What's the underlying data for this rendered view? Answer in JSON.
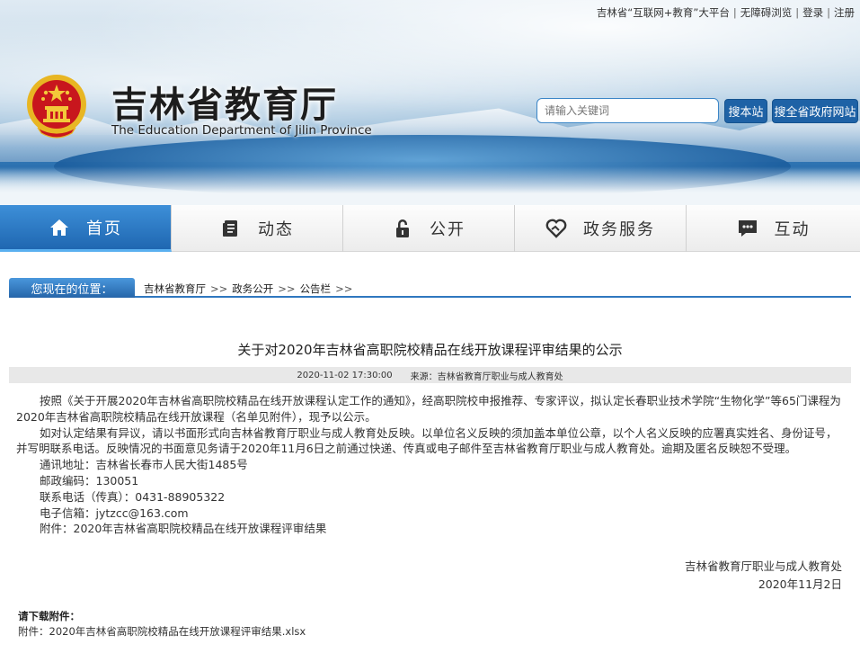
{
  "top_links": [
    "吉林省“互联网+教育”大平台",
    "无障碍浏览",
    "登录",
    "注册"
  ],
  "header": {
    "title": "吉林省教育厅",
    "subtitle": "The Education Department of Jilin Province",
    "search_placeholder": "请输入关键词",
    "search_site_label": "搜本站",
    "search_gov_label": "搜全省政府网站"
  },
  "nav": [
    {
      "label": "首页",
      "icon": "home-icon",
      "active": true
    },
    {
      "label": "动态",
      "icon": "document-icon",
      "active": false
    },
    {
      "label": "公开",
      "icon": "lock-icon",
      "active": false
    },
    {
      "label": "政务服务",
      "icon": "heart-hand-icon",
      "active": false
    },
    {
      "label": "互动",
      "icon": "chat-icon",
      "active": false
    }
  ],
  "breadcrumb": {
    "label": "您现在的位置：",
    "items": [
      "吉林省教育厅",
      "政务公开",
      "公告栏"
    ],
    "arrow": ">>"
  },
  "article": {
    "title": "关于对2020年吉林省高职院校精品在线开放课程评审结果的公示",
    "date": "2020-11-02 17:30:00",
    "source_label": "来源：",
    "source": "吉林省教育厅职业与成人教育处",
    "para1": "按照《关于开展2020年吉林省高职院校精品在线开放课程认定工作的通知》，经高职院校申报推荐、专家评议，拟认定长春职业技术学院“生物化学”等65门课程为2020年吉林省高职院校精品在线开放课程（名单见附件），现予以公示。",
    "para2": "如对认定结果有异议，请以书面形式向吉林省教育厅职业与成人教育处反映。以单位名义反映的须加盖本单位公章，以个人名义反映的应署真实姓名、身份证号，并写明联系电话。反映情况的书面意见务请于2020年11月6日之前通过快递、传真或电子邮件至吉林省教育厅职业与成人教育处。逾期及匿名反映恕不受理。",
    "address": "通讯地址：吉林省长春市人民大街1485号",
    "postcode": "邮政编码：130051",
    "phone": "联系电话（传真）：0431-88905322",
    "email": "电子信箱：jytzcc@163.com",
    "attachment": "附件：2020年吉林省高职院校精品在线开放课程评审结果",
    "signer": "吉林省教育厅职业与成人教育处",
    "sign_date": "2020年11月2日"
  },
  "downloads": {
    "title": "请下载附件：",
    "file": "附件：2020年吉林省高职院校精品在线开放课程评审结果.xlsx"
  },
  "colors": {
    "brand_blue": "#1e62a6",
    "nav_active": "#2f7cc6",
    "emblem_red": "#c8161d",
    "emblem_gold": "#e8b623"
  }
}
